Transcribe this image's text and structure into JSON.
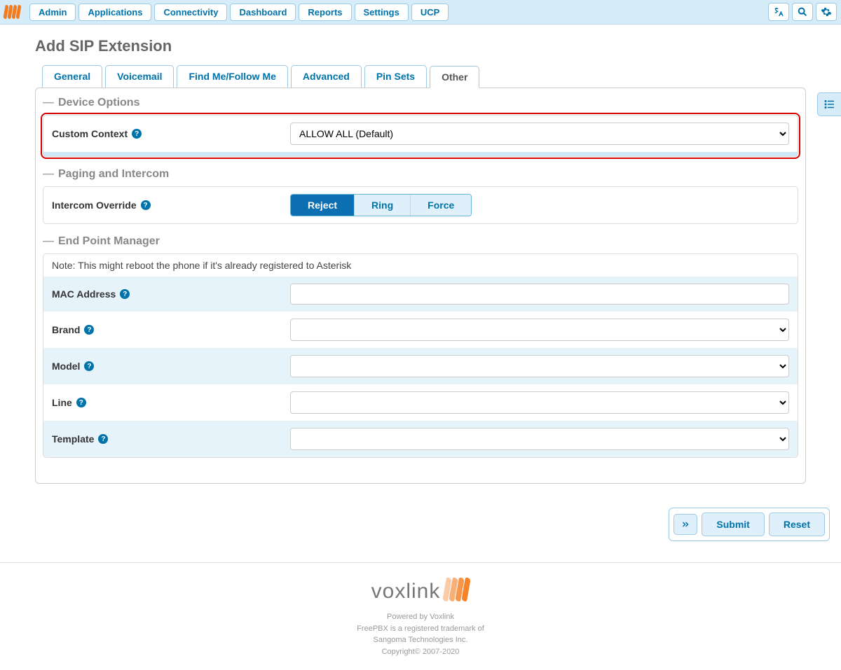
{
  "nav": {
    "items": [
      "Admin",
      "Applications",
      "Connectivity",
      "Dashboard",
      "Reports",
      "Settings",
      "UCP"
    ]
  },
  "page": {
    "title": "Add SIP Extension"
  },
  "tabs": [
    {
      "label": "General"
    },
    {
      "label": "Voicemail"
    },
    {
      "label": "Find Me/Follow Me"
    },
    {
      "label": "Advanced"
    },
    {
      "label": "Pin Sets"
    },
    {
      "label": "Other",
      "active": true
    }
  ],
  "device_options": {
    "title": "Device Options",
    "custom_context": {
      "label": "Custom Context",
      "value": "ALLOW ALL (Default)"
    }
  },
  "paging": {
    "title": "Paging and Intercom",
    "intercom_override": {
      "label": "Intercom Override",
      "options": [
        "Reject",
        "Ring",
        "Force"
      ],
      "selected": "Reject"
    }
  },
  "epm": {
    "title": "End Point Manager",
    "note": "Note: This might reboot the phone if it's already registered to Asterisk",
    "mac": {
      "label": "MAC Address",
      "value": ""
    },
    "brand": {
      "label": "Brand",
      "value": ""
    },
    "model": {
      "label": "Model",
      "value": ""
    },
    "line": {
      "label": "Line",
      "value": ""
    },
    "template": {
      "label": "Template",
      "value": ""
    }
  },
  "actions": {
    "submit": "Submit",
    "reset": "Reset"
  },
  "footer": {
    "brand": "voxlink",
    "line1": "Powered by Voxlink",
    "line2": "FreePBX is a registered trademark of",
    "line3": "Sangoma Technologies Inc.",
    "line4": "Copyright© 2007-2020"
  }
}
